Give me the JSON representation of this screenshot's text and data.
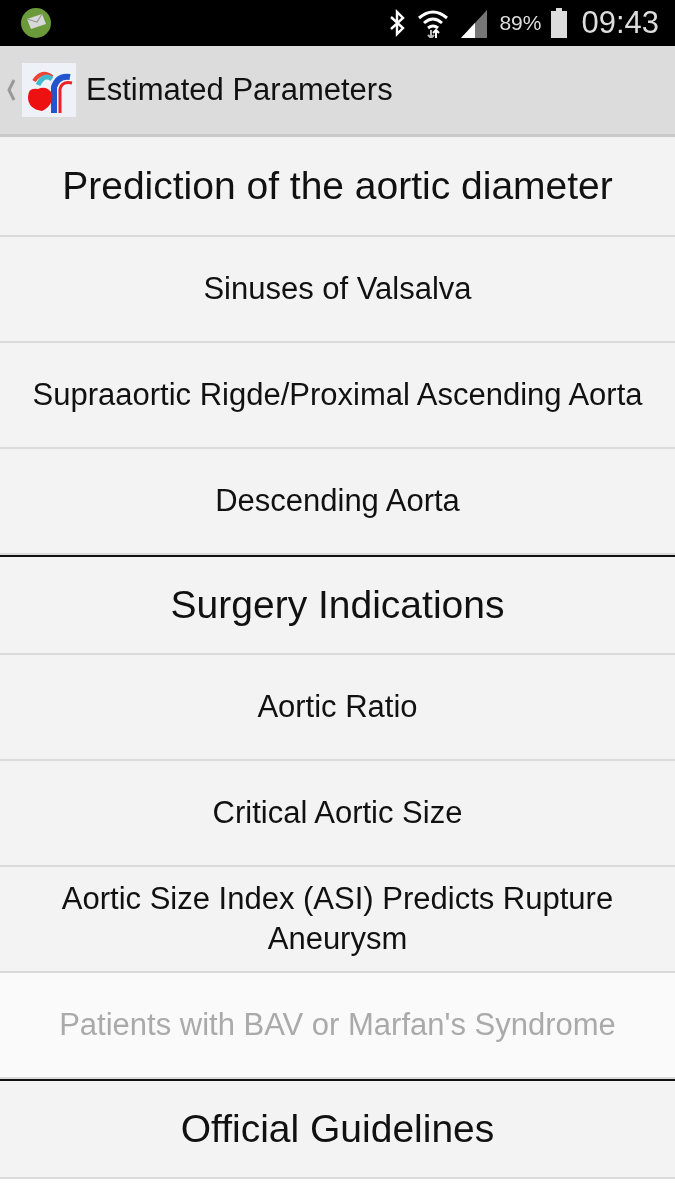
{
  "status_bar": {
    "battery": "89%",
    "time": "09:43"
  },
  "app_bar": {
    "title": "Estimated Parameters"
  },
  "rows": [
    {
      "kind": "section",
      "label": "Prediction of the aortic diameter",
      "disabled": false
    },
    {
      "kind": "item",
      "label": "Sinuses of Valsalva",
      "disabled": false
    },
    {
      "kind": "item",
      "label": "Supraaortic Rigde/Proximal Ascending Aorta",
      "disabled": false
    },
    {
      "kind": "item",
      "label": "Descending Aorta",
      "disabled": false
    },
    {
      "kind": "section",
      "label": "Surgery Indications",
      "disabled": false
    },
    {
      "kind": "item",
      "label": "Aortic Ratio",
      "disabled": false
    },
    {
      "kind": "item",
      "label": "Critical Aortic Size",
      "disabled": false
    },
    {
      "kind": "item",
      "label": "Aortic Size Index (ASI) Predicts Rupture Aneurysm",
      "disabled": false
    },
    {
      "kind": "item",
      "label": "Patients with BAV or Marfan's Syndrome",
      "disabled": true
    },
    {
      "kind": "section",
      "label": "Official Guidelines",
      "disabled": false
    }
  ]
}
